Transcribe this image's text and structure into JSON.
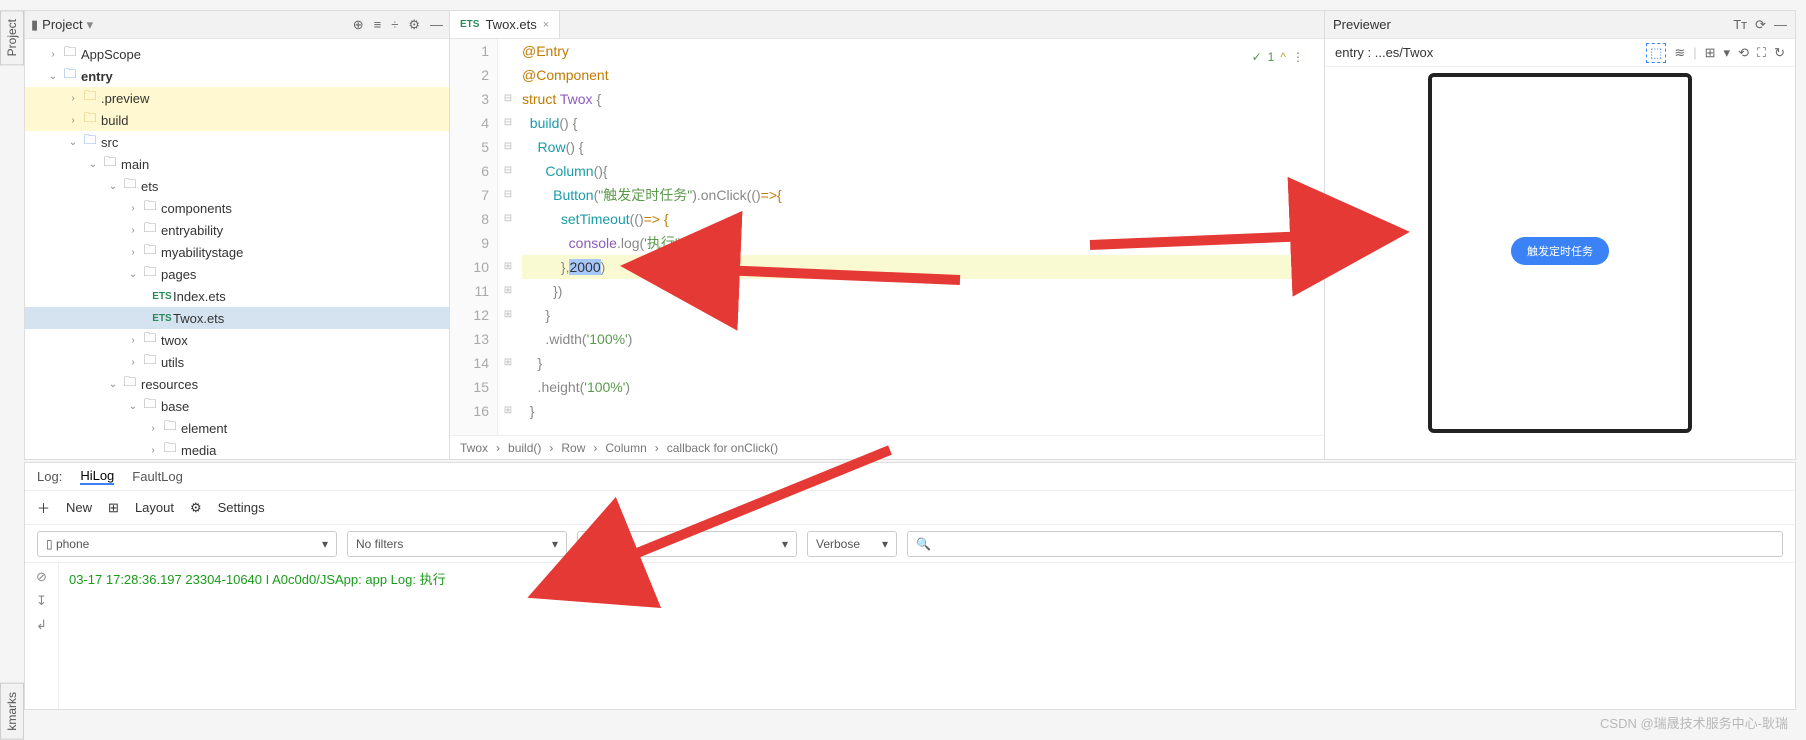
{
  "sidebar_tabs": {
    "project": "Project",
    "bookmarks": "kmarks"
  },
  "project_panel": {
    "title": "Project",
    "tree": {
      "appscope": "AppScope",
      "entry": "entry",
      "preview": ".preview",
      "build": "build",
      "src": "src",
      "main": "main",
      "ets": "ets",
      "components": "components",
      "entryability": "entryability",
      "myabilitystage": "myabilitystage",
      "pages": "pages",
      "index_ets": "Index.ets",
      "twox_ets": "Twox.ets",
      "twox": "twox",
      "utils": "utils",
      "resources": "resources",
      "base": "base",
      "element": "element",
      "media": "media"
    }
  },
  "editor": {
    "tab": "Twox.ets",
    "lines": [
      "1",
      "2",
      "3",
      "4",
      "5",
      "6",
      "7",
      "8",
      "9",
      "10",
      "11",
      "12",
      "13",
      "14",
      "15",
      "16"
    ],
    "code": {
      "l1a": "@Entry",
      "l2a": "@Component",
      "l3a": "struct",
      "l3b": "Twox",
      "l3c": " {",
      "l4a": "  build",
      "l4b": "() {",
      "l5a": "    Row",
      "l5b": "() {",
      "l6a": "      Column",
      "l6b": "(){",
      "l7a": "        Button",
      "l7b": "(",
      "l7c": "\"触发定时任务\"",
      "l7d": ").onClick(()",
      "l7e": "=>{",
      "l8a": "          setTimeout",
      "l8b": "(()",
      "l8c": "=> {",
      "l9a": "            console",
      "l9b": ".log(",
      "l9c": "'执行'",
      "l9d": ")",
      "l10a": "          },",
      "l10b": "2000",
      "l10c": ")",
      "l11a": "        })",
      "l12a": "      }",
      "l13a": "      .width(",
      "l13b": "'100%'",
      "l13c": ")",
      "l14a": "    }",
      "l15a": "    .height(",
      "l15b": "'100%'",
      "l15c": ")",
      "l16a": "  }"
    },
    "status": {
      "check": "✓",
      "count": "1",
      "warn": "^"
    },
    "breadcrumb": [
      "Twox",
      "build()",
      "Row",
      "Column",
      "callback for onClick()"
    ]
  },
  "previewer": {
    "title": "Previewer",
    "entry": "entry : ...es/Twox",
    "button": "触发定时任务"
  },
  "log": {
    "tabs": {
      "log": "Log:",
      "hilog": "HiLog",
      "faultlog": "FaultLog"
    },
    "tools": {
      "new": "New",
      "layout": "Layout",
      "settings": "Settings"
    },
    "filters": {
      "device": "phone",
      "filter": "No filters",
      "empty": "",
      "level": "Verbose",
      "search": "Q"
    },
    "line": "03-17 17:28:36.197 23304-10640 I A0c0d0/JSApp: app Log: 执行"
  },
  "watermark": "CSDN @瑞晟技术服务中心-耿瑞"
}
